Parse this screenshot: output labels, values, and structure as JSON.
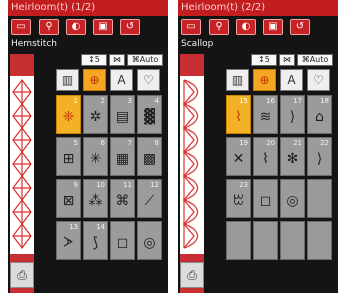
{
  "panels": [
    {
      "title": "Heirloom(t) (1/2)",
      "stitch_name": "Hemstitch",
      "selected_number": "1",
      "stitches": [
        {
          "num": "1",
          "icon": "❈"
        },
        {
          "num": "2",
          "icon": "✲"
        },
        {
          "num": "3",
          "icon": "▤"
        },
        {
          "num": "4",
          "icon": "▓"
        },
        {
          "num": "5",
          "icon": "⊞"
        },
        {
          "num": "6",
          "icon": "✳"
        },
        {
          "num": "7",
          "icon": "▦"
        },
        {
          "num": "8",
          "icon": "▩"
        },
        {
          "num": "9",
          "icon": "⊠"
        },
        {
          "num": "10",
          "icon": "⁂"
        },
        {
          "num": "11",
          "icon": "⌘"
        },
        {
          "num": "12",
          "icon": "⟋"
        },
        {
          "num": "13",
          "icon": "ᗆ"
        },
        {
          "num": "14",
          "icon": "⟆"
        },
        {
          "num": "",
          "icon": "◻"
        },
        {
          "num": "",
          "icon": "◎"
        }
      ]
    },
    {
      "title": "Heirloom(t) (2/2)",
      "stitch_name": "Scallop",
      "selected_number": "15",
      "stitches": [
        {
          "num": "15",
          "icon": "⌇"
        },
        {
          "num": "16",
          "icon": "≋"
        },
        {
          "num": "17",
          "icon": "⟩"
        },
        {
          "num": "18",
          "icon": "⌂"
        },
        {
          "num": "19",
          "icon": "✕"
        },
        {
          "num": "20",
          "icon": "⌇"
        },
        {
          "num": "21",
          "icon": "✻"
        },
        {
          "num": "22",
          "icon": "⟩"
        },
        {
          "num": "23",
          "icon": "ꔱ"
        },
        {
          "num": "",
          "icon": "◻"
        },
        {
          "num": "",
          "icon": "◎"
        }
      ]
    }
  ],
  "indicators": {
    "length": "↕5",
    "width": "⋈",
    "tension": "⌘Auto"
  },
  "categories": [
    "▥",
    "⊕",
    "A",
    "♡"
  ],
  "colors": {
    "header": "#c21d1f",
    "screen": "#141414",
    "accent": "#f3b128"
  }
}
